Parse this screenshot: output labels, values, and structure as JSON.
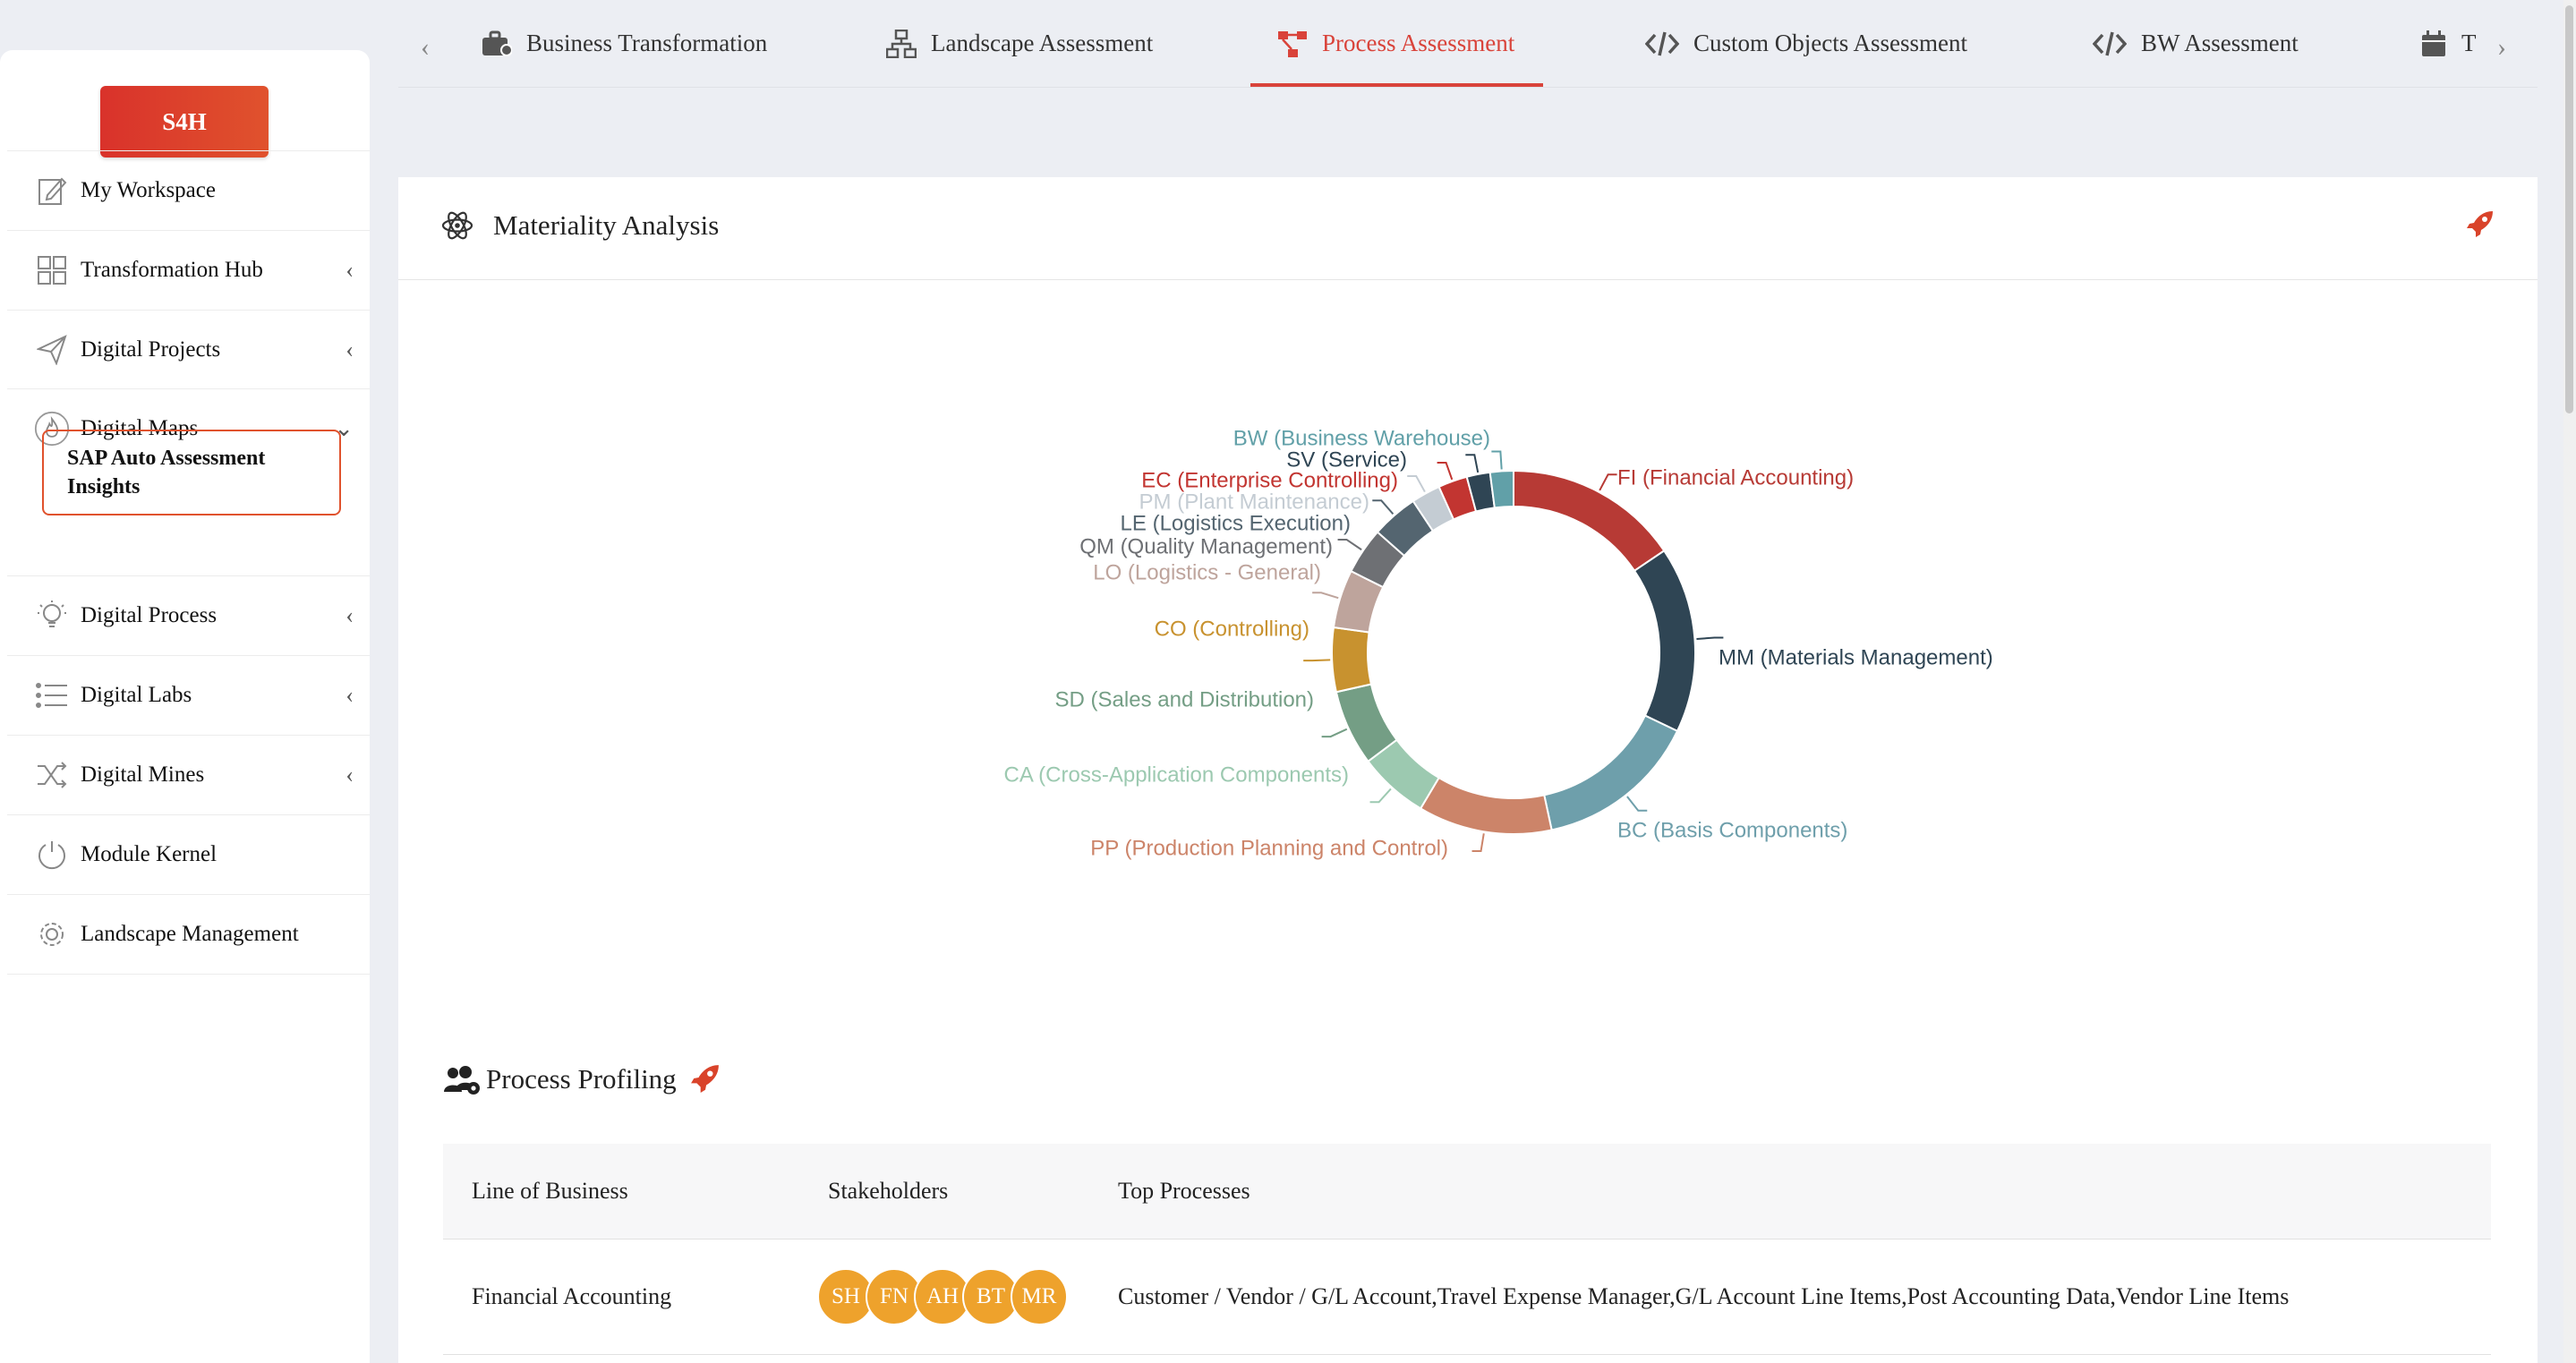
{
  "app": {
    "logo": "S4H"
  },
  "sidebar": {
    "items": [
      {
        "label": "My Workspace",
        "icon": "edit-icon",
        "chevron": ""
      },
      {
        "label": "Transformation Hub",
        "icon": "grid-icon",
        "chevron": "‹"
      },
      {
        "label": "Digital Projects",
        "icon": "send-icon",
        "chevron": "‹"
      },
      {
        "label": "Digital Maps",
        "icon": "flame-icon",
        "chevron": "⌄"
      },
      {
        "label": "Digital Process",
        "icon": "bulb-icon",
        "chevron": "‹"
      },
      {
        "label": "Digital Labs",
        "icon": "list-icon",
        "chevron": "‹"
      },
      {
        "label": "Digital Mines",
        "icon": "shuffle-icon",
        "chevron": "‹"
      },
      {
        "label": "Module Kernel",
        "icon": "power-icon",
        "chevron": ""
      },
      {
        "label": "Landscape Management",
        "icon": "gear-icon",
        "chevron": ""
      }
    ],
    "sub_item": "SAP Auto Assessment Insights"
  },
  "tabs": [
    {
      "label": "Business Transformation",
      "icon": "briefcase-icon"
    },
    {
      "label": "Landscape Assessment",
      "icon": "network-icon"
    },
    {
      "label": "Process Assessment",
      "icon": "process-icon"
    },
    {
      "label": "Custom Objects Assessment",
      "icon": "code-icon"
    },
    {
      "label": "BW Assessment",
      "icon": "code-icon"
    },
    {
      "label": "T",
      "icon": "calendar-icon"
    }
  ],
  "active_tab": "Process Assessment",
  "materiality": {
    "title": "Materiality Analysis"
  },
  "chart_data": {
    "type": "pie",
    "donut": true,
    "title": "",
    "slices": [
      {
        "label": "FI (Financial Accounting)",
        "value": 15.0,
        "color": "#b73a35"
      },
      {
        "label": "MM (Materials Management)",
        "value": 16.0,
        "color": "#2f4554"
      },
      {
        "label": "BC (Basis Components)",
        "value": 14.0,
        "color": "#6e9fab"
      },
      {
        "label": "PP (Production Planning and Control)",
        "value": 11.5,
        "color": "#cc8469"
      },
      {
        "label": "CA (Cross-Application Components)",
        "value": 6.0,
        "color": "#9cc9b0"
      },
      {
        "label": "SD (Sales and Distribution)",
        "value": 6.5,
        "color": "#749e85"
      },
      {
        "label": "CO (Controlling)",
        "value": 5.5,
        "color": "#c8922f"
      },
      {
        "label": "LO (Logistics - General)",
        "value": 5.0,
        "color": "#bea49c"
      },
      {
        "label": "QM (Quality Management)",
        "value": 4.0,
        "color": "#6e7074"
      },
      {
        "label": "LE (Logistics Execution)",
        "value": 4.0,
        "color": "#546570"
      },
      {
        "label": "PM (Plant Maintenance)",
        "value": 2.5,
        "color": "#c4ccd3"
      },
      {
        "label": "EC (Enterprise Controlling)",
        "value": 2.5,
        "color": "#c23531"
      },
      {
        "label": "SV (Service)",
        "value": 2.0,
        "color": "#2f4554"
      },
      {
        "label": "BW (Business Warehouse)",
        "value": 2.0,
        "color": "#61a0a8"
      }
    ]
  },
  "profiling": {
    "title": "Process Profiling",
    "columns": [
      "Line of Business",
      "Stakeholders",
      "Top Processes"
    ],
    "rows": [
      {
        "lob": "Financial Accounting",
        "stakeholders": [
          "SH",
          "FN",
          "AH",
          "BT",
          "MR"
        ],
        "processes": "Customer / Vendor / G/L Account,Travel Expense Manager,G/L Account Line Items,Post Accounting Data,Vendor Line Items"
      }
    ]
  }
}
